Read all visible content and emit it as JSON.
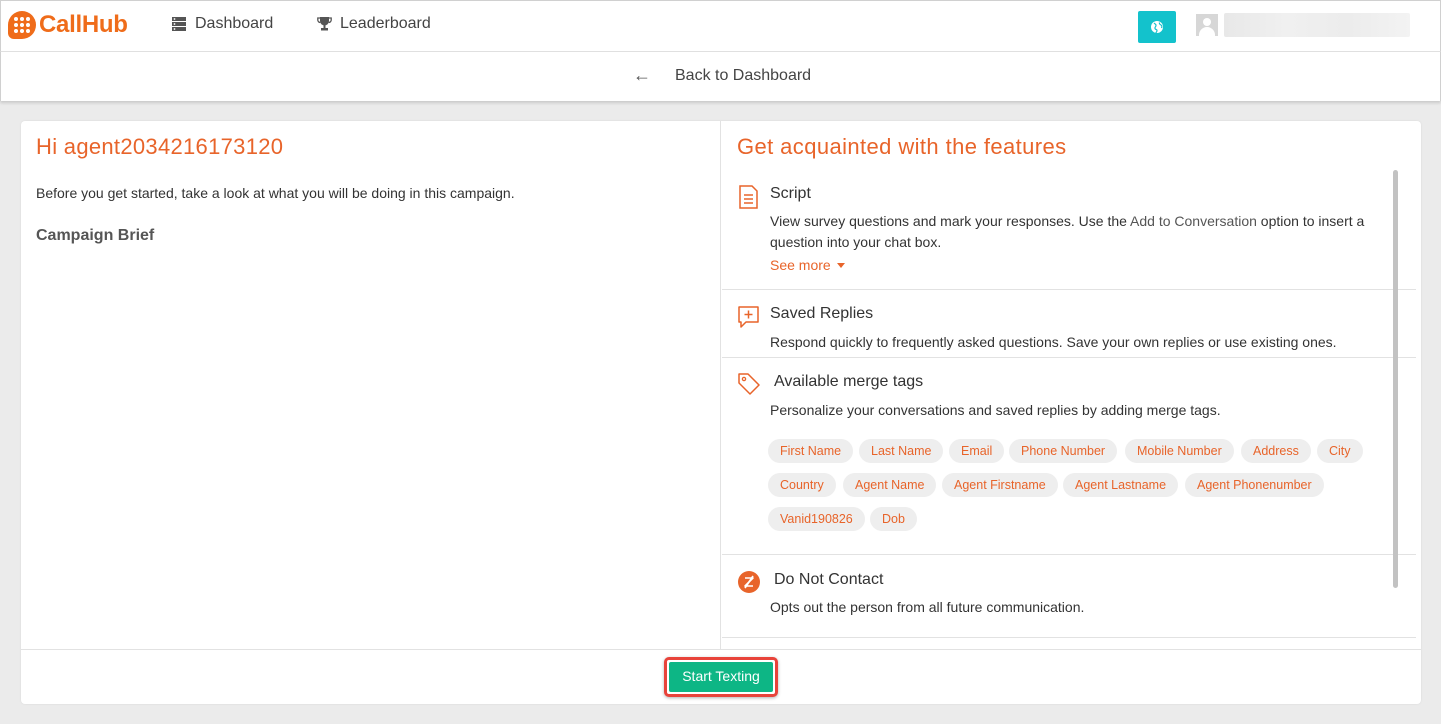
{
  "header": {
    "logo_text": "CallHub",
    "nav": [
      {
        "label": "Dashboard",
        "icon": "server-icon"
      },
      {
        "label": "Leaderboard",
        "icon": "trophy-icon"
      }
    ],
    "globe_icon": "globe-icon",
    "accent_color": "#13c2cc"
  },
  "subnav": {
    "back_label": "Back to Dashboard"
  },
  "left": {
    "greeting": "Hi agent2034216173120",
    "intro": "Before you get started, take a look at what you will be doing in this campaign.",
    "brief_heading": "Campaign Brief"
  },
  "right": {
    "title": "Get acquainted with the features",
    "script": {
      "title": "Script",
      "desc_before": "View survey questions and mark your responses. Use the ",
      "desc_highlight": "Add to Conversation",
      "desc_after": " option to insert a question into your chat box.",
      "see_more": "See more"
    },
    "saved_replies": {
      "title": "Saved Replies",
      "desc": "Respond quickly to frequently asked questions. Save your own replies or use existing ones."
    },
    "merge_tags": {
      "title": "Available merge tags",
      "desc": "Personalize your conversations and saved replies by adding merge tags.",
      "tags": [
        "First Name",
        "Last Name",
        "Email",
        "Phone Number",
        "Mobile Number",
        "Address",
        "City",
        "Country",
        "Agent Name",
        "Agent Firstname",
        "Agent Lastname",
        "Agent Phonenumber",
        "Vanid190826",
        "Dob"
      ]
    },
    "do_not_contact": {
      "title": "Do Not Contact",
      "desc": "Opts out the person from all future communication."
    }
  },
  "footer": {
    "start_label": "Start Texting",
    "button_color": "#0db685"
  },
  "brand_color": "#e8642a"
}
